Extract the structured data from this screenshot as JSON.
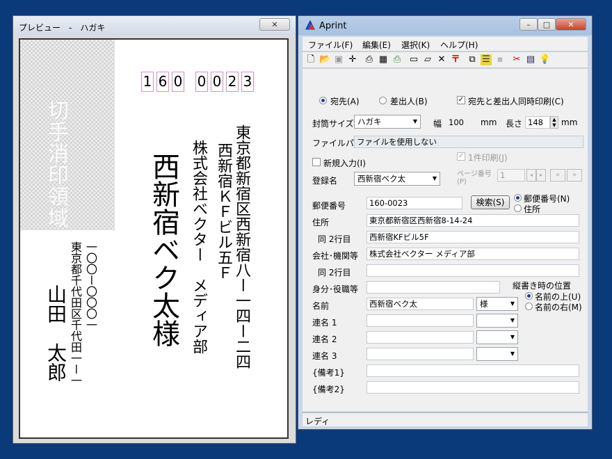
{
  "preview": {
    "title": "プレビュー　-　ハガキ",
    "stamp_area": "切手消印領域",
    "postal_digits": [
      "1",
      "6",
      "0",
      "0",
      "0",
      "2",
      "3"
    ],
    "recipient_address": "東京都新宿区西新宿八ー一四ー二四",
    "recipient_building": "西新宿ＫＦビル五Ｆ",
    "recipient_company": "株式会社ベクター　メディア部",
    "recipient_name": "西新宿ベク太様",
    "sender_postal": "一〇〇ー〇〇〇一",
    "sender_address": "東京都千代田区千代田一ー一",
    "sender_name": "山田　太郎"
  },
  "app": {
    "title": "Aprint",
    "menu": [
      "ファイル(F)",
      "編集(E)",
      "選択(K)",
      "ヘルプ(H)"
    ],
    "toolbar_icons": [
      "new-icon",
      "open-icon",
      "save-icon",
      "target-icon",
      "print-icon",
      "list-icon",
      "print-all-icon",
      "card-icon",
      "card2-icon",
      "delete-icon",
      "postal-mark-icon",
      "copy-icon",
      "grid-icon",
      "blank-icon",
      "cut-icon",
      "layout-icon",
      "bulb-icon"
    ],
    "radio_to": "宛先(A)",
    "radio_from": "差出人(B)",
    "check_both": "宛先と差出人同時印刷(C)",
    "envelope_label": "封筒サイズ",
    "envelope_value": "ハガキ",
    "width_label": "幅",
    "width_value": "100",
    "width_unit": "mm",
    "height_label": "長さ",
    "height_value": "148",
    "height_unit": "mm",
    "filepath_label": "ファイルパス",
    "filepath_value": "ファイルを使用しない",
    "new_entry_label": "新規入力(I)",
    "single_print_label": "1件印刷(J)",
    "page_label": "ページ番号(P)",
    "page_value": "1",
    "reg_label": "登録名",
    "reg_value": "西新宿ベク太",
    "postal_label": "郵便番号",
    "postal_value": "160-0023",
    "search_button": "検索(S)",
    "radio_postal": "郵便番号(N)",
    "radio_address": "住所",
    "address_label": "住所",
    "address_value": "東京都新宿区西新宿8-14-24",
    "address2_label": "同 2行目",
    "address2_value": "西新宿KFビル5F",
    "company_label": "会社･機関等",
    "company_value": "株式会社ベクター メディア部",
    "company2_label": "同 2行目",
    "company2_value": "",
    "position_label": "身分･役職等",
    "position_value": "",
    "vertical_pos_label": "縦書き時の位置",
    "radio_above": "名前の上(U)",
    "radio_right": "名前の右(M)",
    "name_label": "名前",
    "name_value": "西新宿ベク太",
    "honorific": "様",
    "joint1_label": "連名 1",
    "joint2_label": "連名 2",
    "joint3_label": "連名 3",
    "note1_label": "{備考1}",
    "note2_label": "{備考2}",
    "status": "レディ"
  }
}
